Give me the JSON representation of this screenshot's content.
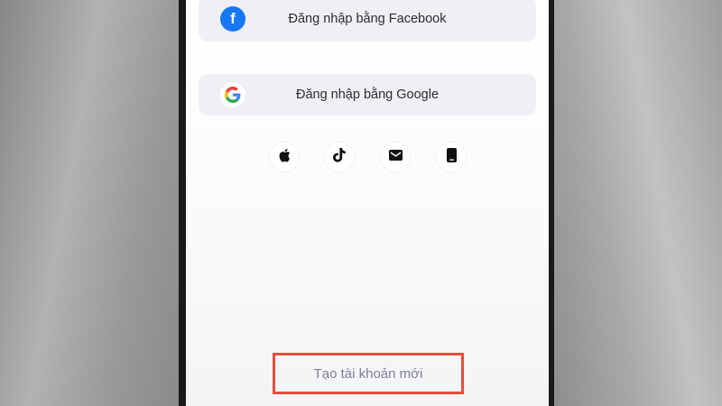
{
  "login_options": {
    "facebook": {
      "label": "Đăng nhập bằng Facebook",
      "icon": "facebook-icon",
      "icon_color": "#1877f2"
    },
    "google": {
      "label": "Đăng nhập bằng Google",
      "icon": "google-icon"
    }
  },
  "social_icons": [
    "apple-icon",
    "tiktok-icon",
    "email-icon",
    "phone-icon"
  ],
  "create_account": {
    "label": "Tạo tài khoản mới",
    "highlight_color": "#e0503c"
  }
}
